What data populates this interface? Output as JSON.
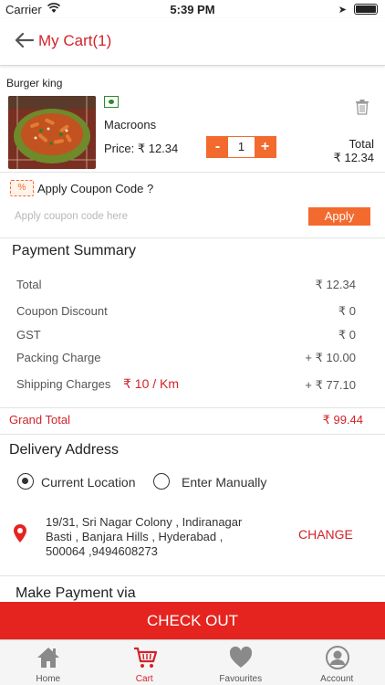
{
  "status_bar": {
    "carrier": "Carrier",
    "time": "5:39 PM"
  },
  "nav": {
    "title": "My Cart(1)"
  },
  "cart": {
    "store_name": "Burger king",
    "item": {
      "name": "Macroons",
      "price": "Price: ₹ 12.34",
      "quantity": "1",
      "total_label": "Total",
      "total_value": "₹ 12.34"
    },
    "stepper": {
      "minus": "-",
      "plus": "+"
    }
  },
  "coupon": {
    "title": "Apply Coupon Code ?",
    "placeholder": "Apply coupon code here",
    "apply_label": "Apply",
    "icon_glyph": "%"
  },
  "payment_summary": {
    "title": "Payment Summary",
    "rows": [
      {
        "label": "Total",
        "value": "₹ 12.34"
      },
      {
        "label": "Coupon Discount",
        "value": "₹ 0"
      },
      {
        "label": "GST",
        "value": "₹ 0"
      },
      {
        "label": "Packing Charge",
        "value": "+ ₹ 10.00"
      },
      {
        "label": "Shipping Charges",
        "value": "+ ₹ 77.10"
      }
    ],
    "shipping_rate": "₹ 10 / Km",
    "grand_total_label": "Grand Total",
    "grand_total_value": "₹ 99.44"
  },
  "delivery": {
    "title": "Delivery Address",
    "option_current": "Current Location",
    "option_manual": "Enter Manually",
    "selected": "current",
    "address": "19/31,  Sri Nagar Colony ,  Indiranagar\nBasti ,  Banjara Hills ,  Hyderabad ,\n500064 ,9494608273",
    "change_label": "CHANGE"
  },
  "payment": {
    "title": "Make Payment via"
  },
  "checkout_label": "CHECK OUT",
  "tabs": [
    {
      "label": "Home",
      "icon": "home-icon"
    },
    {
      "label": "Cart",
      "icon": "cart-icon",
      "active": true
    },
    {
      "label": "Favourites",
      "icon": "heart-icon"
    },
    {
      "label": "Account",
      "icon": "account-icon"
    }
  ],
  "colors": {
    "brand_red": "#d2232a",
    "accent_orange": "#f26a2e",
    "checkout_red": "#e5241f",
    "veg_green": "#2a8a2a"
  }
}
